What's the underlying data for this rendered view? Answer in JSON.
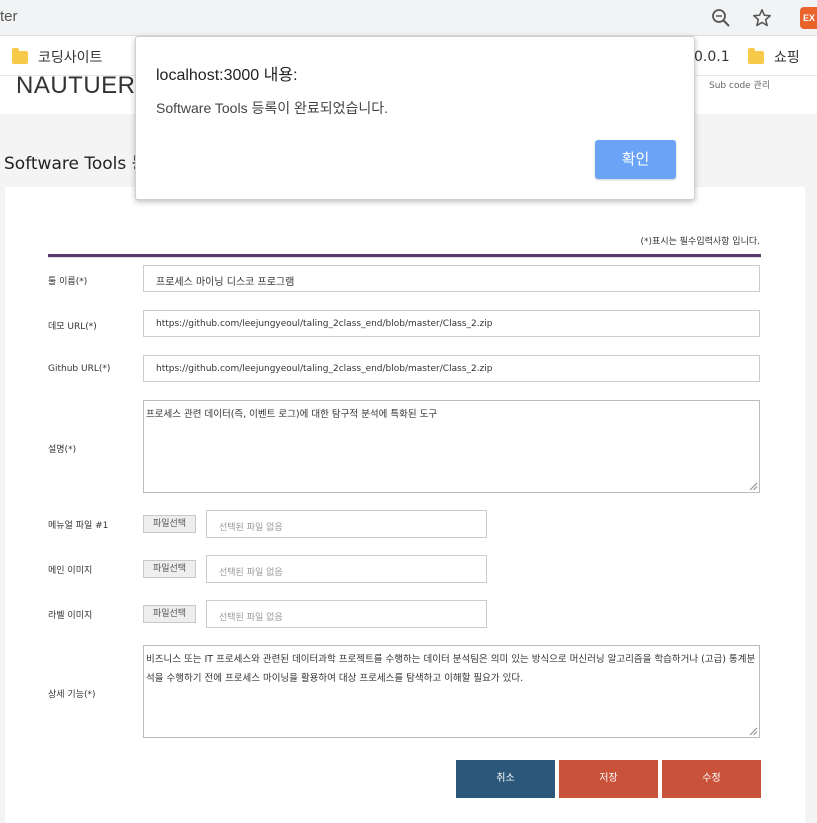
{
  "browser": {
    "url_fragment": "ter",
    "bookmarks": [
      {
        "label": "코딩사이트"
      },
      {
        "label": "0.0.1"
      },
      {
        "label": "쇼핑"
      }
    ],
    "extension_label": "EX"
  },
  "site": {
    "logo": "NAUTUER",
    "sub_code_text": "Sub code 관리",
    "page_title": "Software Tools 등"
  },
  "form": {
    "required_note": "(*)표시는 필수입력사항 입니다.",
    "fields": {
      "tool_name": {
        "label": "툴 이름(*)",
        "value": "프로세스 마이닝 디스코 프로그램"
      },
      "demo_url": {
        "label": "데모 URL(*)",
        "value": "https://github.com/leejungyeoul/taling_2class_end/blob/master/Class_2.zip"
      },
      "github_url": {
        "label": "Github URL(*)",
        "value": "https://github.com/leejungyeoul/taling_2class_end/blob/master/Class_2.zip"
      },
      "description": {
        "label": "설명(*)",
        "value": "프로세스 관련 데이터(즉, 이벤트 로그)에 대한 탐구적 분석에 특화된 도구"
      },
      "manual_file": {
        "label": "메뉴얼 파일 #1",
        "button": "파일선택",
        "placeholder": "선택된 파일 없음"
      },
      "main_image": {
        "label": "메인 이미지",
        "button": "파일선택",
        "placeholder": "선택된 파일 없음"
      },
      "label_image": {
        "label": "라벨 이미지",
        "button": "파일선택",
        "placeholder": "선택된 파일 없음"
      },
      "detail": {
        "label": "상세 기능(*)",
        "value": "비즈니스 또는 IT 프로세스와 관련된 데이터과학 프로젝트를 수행하는 데이터 분석팀은 의미 있는 방식으로 머신러닝 알고리즘을 학습하거나 (고급) 통계분석을 수행하기 전에 프로세스 마이닝을 활용하여 대상 프로세스를 탐색하고 이해할 필요가 있다."
      }
    },
    "buttons": {
      "cancel": "취소",
      "save": "저장",
      "edit": "수정"
    }
  },
  "dialog": {
    "title": "localhost:3000 내용:",
    "message": "Software Tools 등록이 완료되었습니다.",
    "ok_label": "확인"
  },
  "colors": {
    "dialog_ok": "#6ba4f7",
    "cancel_button": "#2b587a",
    "save_button": "#c8533a",
    "form_rule": "#5a3a6e"
  }
}
